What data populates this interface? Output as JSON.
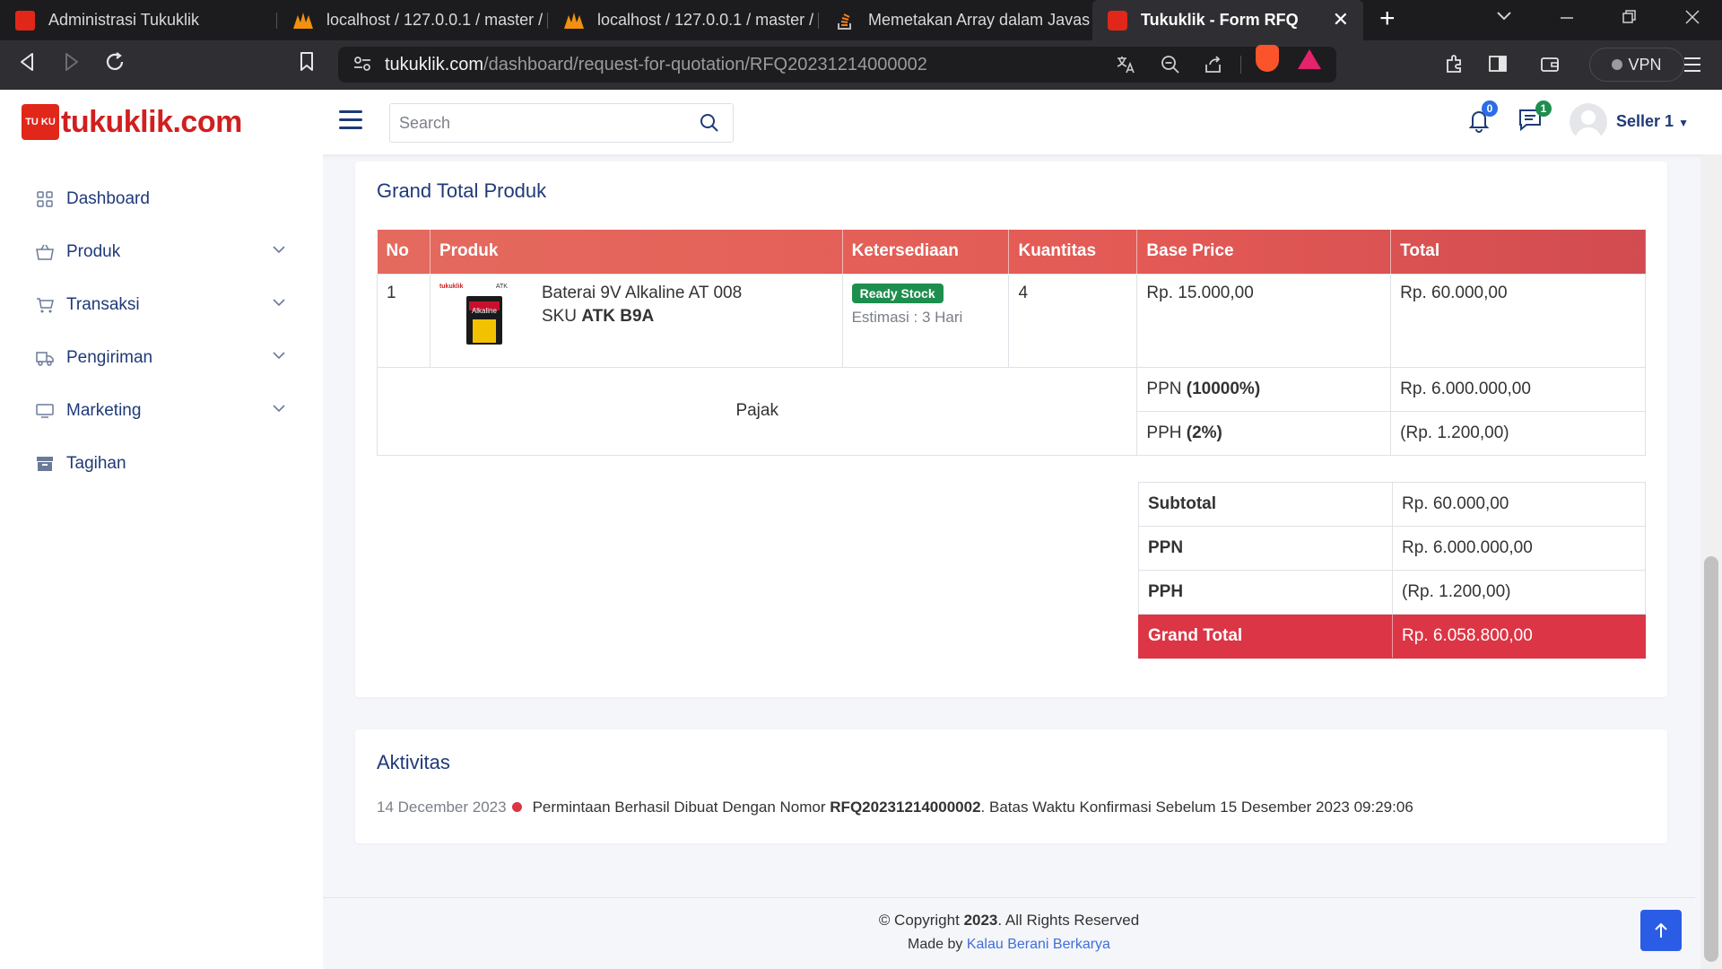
{
  "browser": {
    "tabs": [
      {
        "label": "Administrasi Tukuklik"
      },
      {
        "label": "localhost / 127.0.0.1 / master / "
      },
      {
        "label": "localhost / 127.0.0.1 / master / "
      },
      {
        "label": "Memetakan Array dalam Javascr"
      },
      {
        "label": "Tukuklik - Form RFQ"
      }
    ],
    "url_host": "tukuklik.com",
    "url_path": "/dashboard/request-for-quotation/RFQ20231214000002",
    "vpn_label": "VPN"
  },
  "app": {
    "logo_text": "tukuklik.com",
    "logo_badge": "TU KU",
    "search_placeholder": "Search",
    "notif_count": "0",
    "message_count": "1",
    "user_name": "Seller 1",
    "colors": {
      "brand": "#d11f1f",
      "navy": "#1f3a78",
      "table_header": "#e46a5e",
      "grand_total": "#dc3545",
      "ready": "#1e8e4e"
    }
  },
  "sidebar": {
    "items": [
      {
        "label": "Dashboard",
        "icon": "grid-icon"
      },
      {
        "label": "Produk",
        "icon": "basket-icon"
      },
      {
        "label": "Transaksi",
        "icon": "cart-icon"
      },
      {
        "label": "Pengiriman",
        "icon": "truck-icon"
      },
      {
        "label": "Marketing",
        "icon": "monitor-icon"
      },
      {
        "label": "Tagihan",
        "icon": "archive-icon"
      }
    ]
  },
  "grand_total_card": {
    "title": "Grand Total Produk",
    "headers": [
      "No",
      "Produk",
      "Ketersediaan",
      "Kuantitas",
      "Base Price",
      "Total"
    ],
    "product": {
      "no": "1",
      "name": "Baterai 9V Alkaline AT 008",
      "sku_prefix": "SKU",
      "sku": "ATK B9A",
      "availability": "Ready Stock",
      "estimate": "Estimasi : 3 Hari",
      "quantity": "4",
      "base_price": "Rp. 15.000,00",
      "total": "Rp. 60.000,00",
      "image_brand": "Alkaline"
    },
    "tax": {
      "label": "Pajak",
      "ppn_label": "PPN",
      "ppn_rate": "(10000%)",
      "ppn_value": "Rp. 6.000.000,00",
      "pph_label": "PPH",
      "pph_rate": "(2%)",
      "pph_value": "(Rp. 1.200,00)"
    },
    "summary": {
      "subtotal_label": "Subtotal",
      "subtotal_value": "Rp. 60.000,00",
      "ppn_label": "PPN",
      "ppn_value": "Rp. 6.000.000,00",
      "pph_label": "PPH",
      "pph_value": "(Rp. 1.200,00)",
      "grand_label": "Grand Total",
      "grand_value": "Rp. 6.058.800,00"
    }
  },
  "activity_card": {
    "title": "Aktivitas",
    "date": "14 December 2023",
    "text_before": "Permintaan Berhasil Dibuat Dengan Nomor",
    "rfq": "RFQ20231214000002",
    "text_after": ". Batas Waktu Konfirmasi Sebelum 15 Desember 2023 09:29:06"
  },
  "footer": {
    "copyright_prefix": "© Copyright",
    "year": "2023",
    "rights": ". All Rights Reserved",
    "made_by": "Made by",
    "made_by_link": "Kalau Berani Berkarya"
  }
}
